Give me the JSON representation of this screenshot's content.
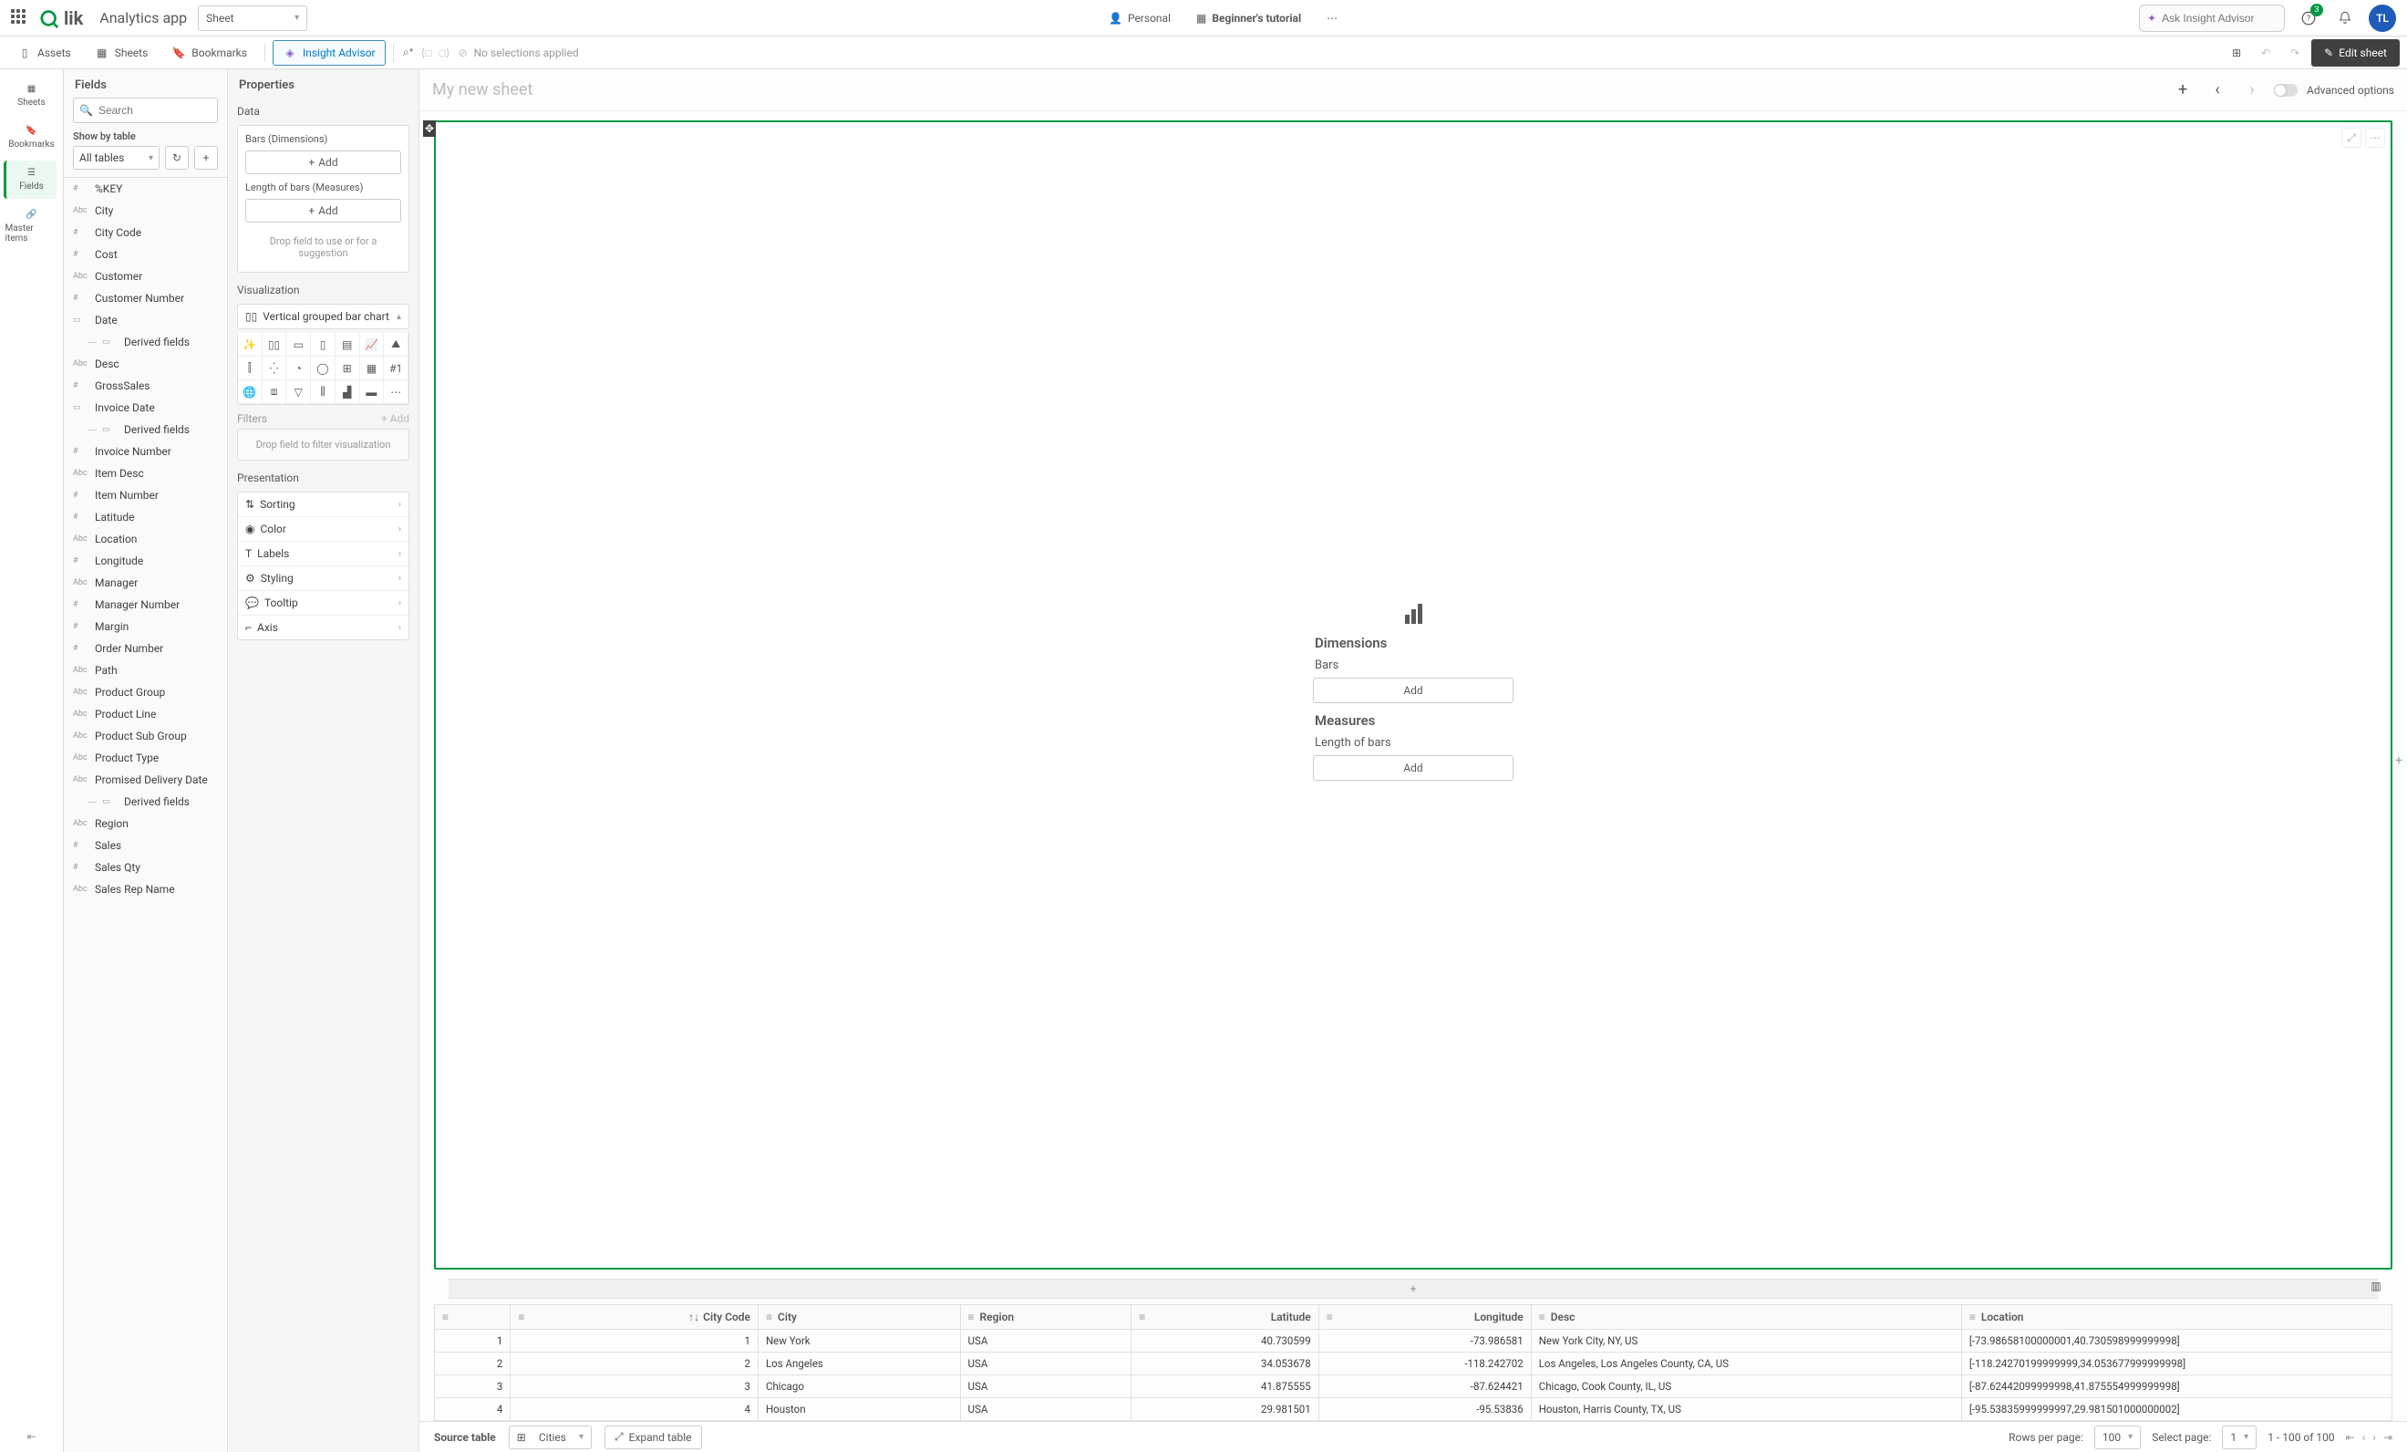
{
  "topbar": {
    "appName": "Analytics app",
    "sheetSelector": "Sheet",
    "personal": "Personal",
    "tutorial": "Beginner's tutorial",
    "searchPlaceholder": "Ask Insight Advisor",
    "notifBadge": "3",
    "avatar": "TL"
  },
  "toolbar": {
    "assets": "Assets",
    "sheets": "Sheets",
    "bookmarks": "Bookmarks",
    "insight": "Insight Advisor",
    "noSelections": "No selections applied",
    "editSheet": "Edit sheet"
  },
  "rail": {
    "sheets": "Sheets",
    "bookmarks": "Bookmarks",
    "fields": "Fields",
    "master": "Master items"
  },
  "fieldsPanel": {
    "title": "Fields",
    "searchPlaceholder": "Search",
    "showBy": "Show by table",
    "tablesSel": "All tables",
    "fields": [
      {
        "t": "#",
        "n": "%KEY"
      },
      {
        "t": "Abc",
        "n": "City"
      },
      {
        "t": "#",
        "n": "City Code"
      },
      {
        "t": "#",
        "n": "Cost"
      },
      {
        "t": "Abc",
        "n": "Customer"
      },
      {
        "t": "#",
        "n": "Customer Number"
      },
      {
        "t": "cal",
        "n": "Date"
      },
      {
        "t": "der",
        "n": "Derived fields"
      },
      {
        "t": "Abc",
        "n": "Desc"
      },
      {
        "t": "#",
        "n": "GrossSales"
      },
      {
        "t": "cal",
        "n": "Invoice Date"
      },
      {
        "t": "der",
        "n": "Derived fields"
      },
      {
        "t": "#",
        "n": "Invoice Number"
      },
      {
        "t": "Abc",
        "n": "Item Desc"
      },
      {
        "t": "#",
        "n": "Item Number"
      },
      {
        "t": "#",
        "n": "Latitude"
      },
      {
        "t": "Abc",
        "n": "Location"
      },
      {
        "t": "#",
        "n": "Longitude"
      },
      {
        "t": "Abc",
        "n": "Manager"
      },
      {
        "t": "#",
        "n": "Manager Number"
      },
      {
        "t": "#",
        "n": "Margin"
      },
      {
        "t": "#",
        "n": "Order Number"
      },
      {
        "t": "Abc",
        "n": "Path"
      },
      {
        "t": "Abc",
        "n": "Product Group"
      },
      {
        "t": "Abc",
        "n": "Product Line"
      },
      {
        "t": "Abc",
        "n": "Product Sub Group"
      },
      {
        "t": "Abc",
        "n": "Product Type"
      },
      {
        "t": "Abc",
        "n": "Promised Delivery Date"
      },
      {
        "t": "der",
        "n": "Derived fields"
      },
      {
        "t": "Abc",
        "n": "Region"
      },
      {
        "t": "#",
        "n": "Sales"
      },
      {
        "t": "#",
        "n": "Sales Qty"
      },
      {
        "t": "Abc",
        "n": "Sales Rep Name"
      }
    ]
  },
  "props": {
    "title": "Properties",
    "data": "Data",
    "bars": "Bars (Dimensions)",
    "length": "Length of bars (Measures)",
    "add": "Add",
    "dropHint": "Drop field to use or for a suggestion",
    "viz": "Visualization",
    "vizName": "Vertical grouped bar chart",
    "filters": "Filters",
    "filtersAdd": "+ Add",
    "filterDrop": "Drop field to filter visualization",
    "presentation": "Presentation",
    "presItems": [
      "Sorting",
      "Color",
      "Labels",
      "Styling",
      "Tooltip",
      "Axis"
    ]
  },
  "canvas": {
    "title": "My new sheet",
    "advanced": "Advanced options",
    "dimHeader": "Dimensions",
    "dimSub": "Bars",
    "meaHeader": "Measures",
    "meaSub": "Length of bars",
    "add": "Add"
  },
  "table": {
    "columns": [
      "",
      "City Code",
      "City",
      "Region",
      "Latitude",
      "Longitude",
      "Desc",
      "Location"
    ],
    "rows": [
      {
        "i": "1",
        "code": "1",
        "city": "New York",
        "region": "USA",
        "lat": "40.730599",
        "lon": "-73.986581",
        "desc": "New York City, NY, US",
        "loc": "[-73.98658100000001,40.730598999999998]"
      },
      {
        "i": "2",
        "code": "2",
        "city": "Los Angeles",
        "region": "USA",
        "lat": "34.053678",
        "lon": "-118.242702",
        "desc": "Los Angeles, Los Angeles County, CA, US",
        "loc": "[-118.24270199999999,34.053677999999998]"
      },
      {
        "i": "3",
        "code": "3",
        "city": "Chicago",
        "region": "USA",
        "lat": "41.875555",
        "lon": "-87.624421",
        "desc": "Chicago, Cook County, IL, US",
        "loc": "[-87.62442099999998,41.875554999999998]"
      },
      {
        "i": "4",
        "code": "4",
        "city": "Houston",
        "region": "USA",
        "lat": "29.981501",
        "lon": "-95.53836",
        "desc": "Houston, Harris County, TX, US",
        "loc": "[-95.53835999999997,29.981501000000002]"
      }
    ],
    "sourceTable": "Source table",
    "sourceSel": "Cities",
    "expand": "Expand table",
    "rowsPerPage": "Rows per page:",
    "rowsPerPageVal": "100",
    "selectPage": "Select page:",
    "selectPageVal": "1",
    "range": "1 - 100 of 100"
  }
}
